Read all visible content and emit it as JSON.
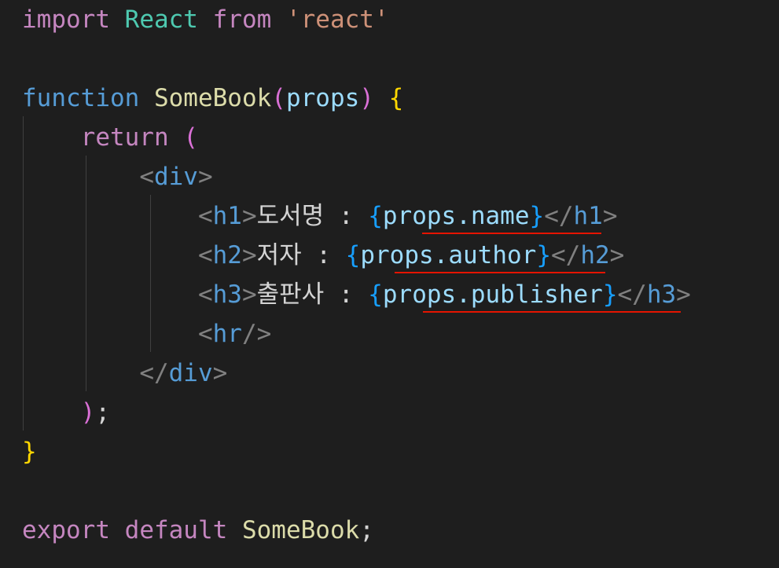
{
  "editor": {
    "background": "#1e1e1e",
    "squiggle_color": "#e51400",
    "lines": {
      "l1": {
        "import": "import",
        "React": "React",
        "from": "from",
        "module": "'react'"
      },
      "l3": {
        "function": "function",
        "name": "SomeBook",
        "open_paren": "(",
        "param": "props",
        "close_paren": ")",
        "open_brace": "{"
      },
      "l4": {
        "return": "return",
        "open_paren": "("
      },
      "l5": {
        "lt": "<",
        "tag": "div",
        "gt": ">"
      },
      "l6": {
        "lt": "<",
        "tag": "h1",
        "gt": ">",
        "text": "도서명 : ",
        "open": "{",
        "expr": "props.name",
        "close": "}",
        "end_lt": "</",
        "end_tag": "h1",
        "end_gt": ">"
      },
      "l7": {
        "lt": "<",
        "tag": "h2",
        "gt": ">",
        "text": "저자 : ",
        "open": "{",
        "expr": "props.author",
        "close": "}",
        "end_lt": "</",
        "end_tag": "h2",
        "end_gt": ">"
      },
      "l8": {
        "lt": "<",
        "tag": "h3",
        "gt": ">",
        "text": "출판사 : ",
        "open": "{",
        "expr": "props.publisher",
        "close": "}",
        "end_lt": "</",
        "end_tag": "h3",
        "end_gt": ">"
      },
      "l9": {
        "lt": "<",
        "tag": "hr",
        "end": "/>"
      },
      "l10": {
        "lt": "</",
        "tag": "div",
        "gt": ">"
      },
      "l11": {
        "close_paren": ")",
        "semicolon": ";"
      },
      "l12": {
        "close_brace": "}"
      },
      "l14": {
        "export": "export",
        "default": "default",
        "name": "SomeBook",
        "semicolon": ";"
      }
    }
  }
}
